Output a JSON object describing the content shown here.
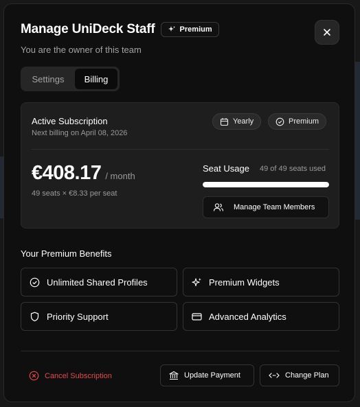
{
  "modal": {
    "title": "Manage UniDeck Staff",
    "title_badge": "Premium",
    "subtitle": "You are the owner of this team"
  },
  "tabs": [
    {
      "label": "Settings",
      "active": false
    },
    {
      "label": "Billing",
      "active": true
    }
  ],
  "subscription": {
    "title": "Active Subscription",
    "next_billing": "Next billing on April 08, 2026",
    "cycle_label": "Yearly",
    "plan_label": "Premium",
    "price": "€408.17",
    "period": "/ month",
    "per_seat": "49 seats × €8.33 per seat",
    "seat_usage_label": "Seat Usage",
    "seat_usage_count": "49 of 49 seats used",
    "seat_usage_fraction": 1.0,
    "manage_label": "Manage Team Members"
  },
  "benefits": {
    "title": "Your Premium Benefits",
    "items": [
      {
        "label": "Unlimited Shared Profiles",
        "icon": "check-circle-icon"
      },
      {
        "label": "Premium Widgets",
        "icon": "sparkle-icon"
      },
      {
        "label": "Priority Support",
        "icon": "shield-icon"
      },
      {
        "label": "Advanced Analytics",
        "icon": "credit-card-icon"
      }
    ]
  },
  "footer": {
    "cancel_label": "Cancel Subscription",
    "update_payment_label": "Update Payment",
    "change_plan_label": "Change Plan"
  },
  "colors": {
    "danger": "#e5484d",
    "modal_bg": "#0f0f0f",
    "card_bg": "#1e1e1e"
  }
}
